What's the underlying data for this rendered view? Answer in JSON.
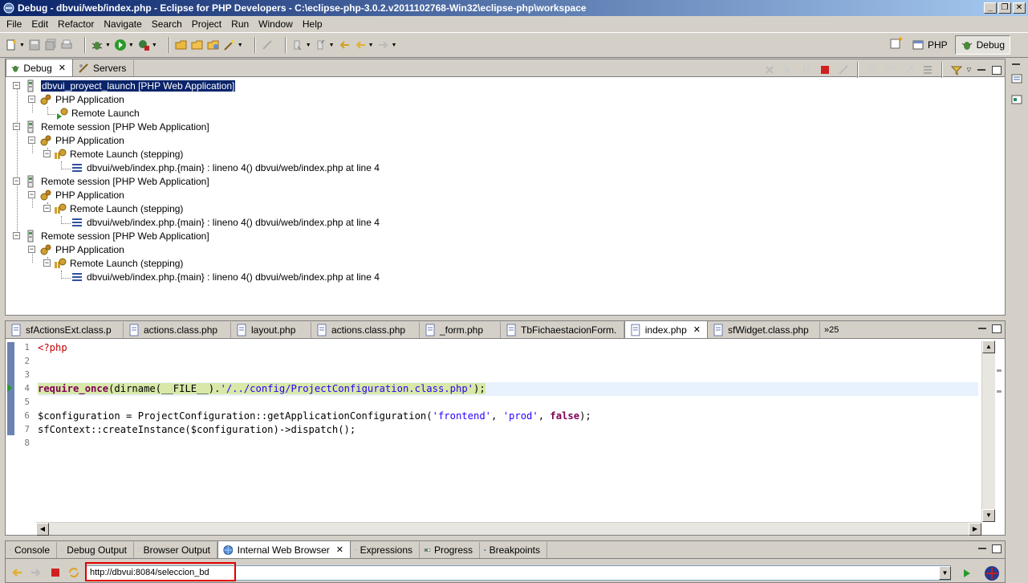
{
  "window": {
    "title": "Debug - dbvui/web/index.php - Eclipse for PHP Developers - C:\\eclipse-php-3.0.2.v2011102768-Win32\\eclipse-php\\workspace",
    "controls": [
      "_",
      "❐",
      "✕"
    ]
  },
  "menu": [
    "File",
    "Edit",
    "Refactor",
    "Navigate",
    "Search",
    "Project",
    "Run",
    "Window",
    "Help"
  ],
  "perspectives": [
    {
      "label": "PHP",
      "active": false
    },
    {
      "label": "Debug",
      "active": true
    }
  ],
  "debug_view": {
    "tabs": [
      {
        "label": "Debug",
        "active": true
      },
      {
        "label": "Servers",
        "active": false
      }
    ],
    "tree": [
      {
        "label": "dbvui_proyect_launch [PHP Web Application]",
        "depth": 0,
        "type": "launch",
        "selected": true
      },
      {
        "label": "PHP Application",
        "depth": 1,
        "type": "app"
      },
      {
        "label": "Remote Launch",
        "depth": 2,
        "type": "remote"
      },
      {
        "label": "Remote session [PHP Web Application]",
        "depth": 0,
        "type": "launch"
      },
      {
        "label": "PHP Application",
        "depth": 1,
        "type": "app"
      },
      {
        "label": "Remote Launch (stepping)",
        "depth": 2,
        "type": "stepping"
      },
      {
        "label": "dbvui/web/index.php.{main} : lineno 4() dbvui/web/index.php at line 4",
        "depth": 3,
        "type": "frame"
      },
      {
        "label": "Remote session [PHP Web Application]",
        "depth": 0,
        "type": "launch"
      },
      {
        "label": "PHP Application",
        "depth": 1,
        "type": "app"
      },
      {
        "label": "Remote Launch (stepping)",
        "depth": 2,
        "type": "stepping"
      },
      {
        "label": "dbvui/web/index.php.{main} : lineno 4() dbvui/web/index.php at line 4",
        "depth": 3,
        "type": "frame"
      },
      {
        "label": "Remote session [PHP Web Application]",
        "depth": 0,
        "type": "launch"
      },
      {
        "label": "PHP Application",
        "depth": 1,
        "type": "app"
      },
      {
        "label": "Remote Launch (stepping)",
        "depth": 2,
        "type": "stepping"
      },
      {
        "label": "dbvui/web/index.php.{main} : lineno 4() dbvui/web/index.php at line 4",
        "depth": 3,
        "type": "frame"
      }
    ]
  },
  "editor": {
    "tabs": [
      {
        "label": "sfActionsExt.class.p",
        "active": false
      },
      {
        "label": "actions.class.php",
        "active": false
      },
      {
        "label": "layout.php",
        "active": false
      },
      {
        "label": "actions.class.php",
        "active": false
      },
      {
        "label": "_form.php",
        "active": false
      },
      {
        "label": "TbFichaestacionForm.",
        "active": false
      },
      {
        "label": "index.php",
        "active": true
      },
      {
        "label": "sfWidget.class.php",
        "active": false
      }
    ],
    "overflow_count": "»25",
    "line_numbers": [
      "1",
      "2",
      "3",
      "4",
      "5",
      "6",
      "7",
      "8"
    ],
    "code": {
      "l1": "<?php",
      "l4_kw": "require_once",
      "l4_a": "(dirname(__FILE__).",
      "l4_str": "'/../config/ProjectConfiguration.class.php'",
      "l4_b": ");",
      "l6_a": "$configuration = ProjectConfiguration::getApplicationConfiguration(",
      "l6_s1": "'frontend'",
      "l6_c": ", ",
      "l6_s2": "'prod'",
      "l6_d": ", ",
      "l6_kw": "false",
      "l6_e": ");",
      "l7": "sfContext::createInstance($configuration)->dispatch();"
    }
  },
  "bottom_view": {
    "tabs": [
      {
        "label": "Console",
        "active": false
      },
      {
        "label": "Debug Output",
        "active": false
      },
      {
        "label": "Browser Output",
        "active": false
      },
      {
        "label": "Internal Web Browser",
        "active": true
      },
      {
        "label": "Expressions",
        "active": false
      },
      {
        "label": "Progress",
        "active": false
      },
      {
        "label": "Breakpoints",
        "active": false
      }
    ],
    "url": "http://dbvui:8084/seleccion_bd"
  },
  "colors": {
    "title_start": "#0a246a",
    "title_end": "#a6caf0",
    "selection": "#0a246a",
    "highlight_line": "#d8e8a8",
    "url_box": "#e00000"
  }
}
